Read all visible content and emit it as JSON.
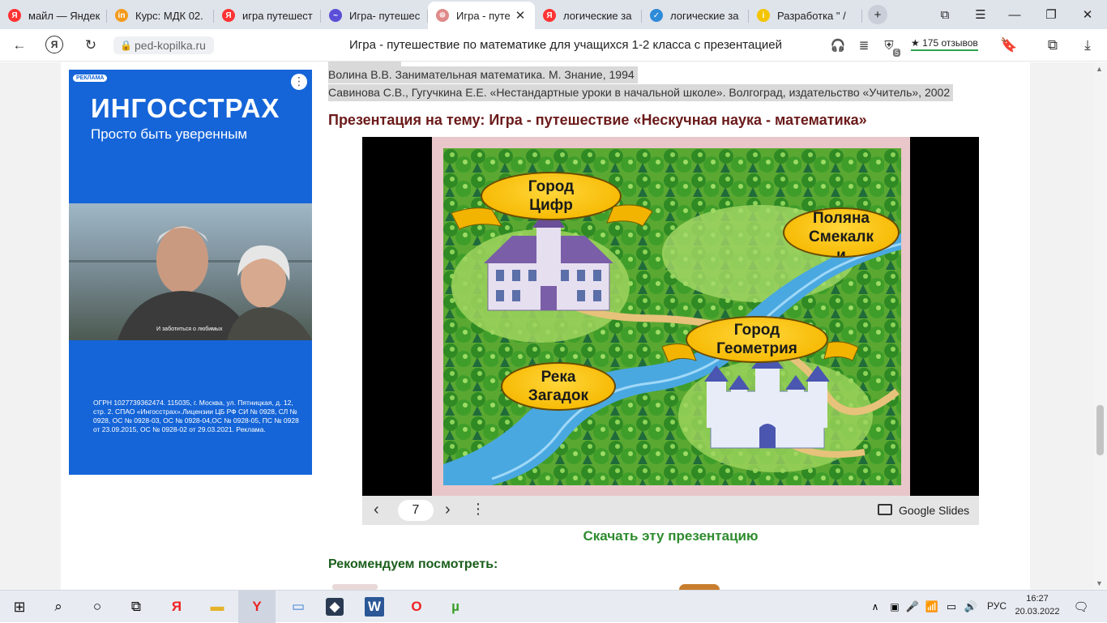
{
  "browser": {
    "tabs": [
      {
        "label": "майл — Яндек",
        "favicon": "Я",
        "favicon_color": "#f33"
      },
      {
        "label": "Курс: МДК 02.",
        "favicon": "in",
        "favicon_color": "#f39a1c"
      },
      {
        "label": "игра путешест",
        "favicon": "Я",
        "favicon_color": "#f33"
      },
      {
        "label": "Игра- путешес",
        "favicon": "~",
        "favicon_color": "#5b4fd8"
      },
      {
        "label": "Игра - путе",
        "favicon": "☸",
        "favicon_color": "#e08a8a",
        "active": true
      },
      {
        "label": "логические за",
        "favicon": "Я",
        "favicon_color": "#f33"
      },
      {
        "label": "логические за",
        "favicon": "✓",
        "favicon_color": "#2e8bd8"
      },
      {
        "label": "Разработка \" /",
        "favicon": "i",
        "favicon_color": "#f5c400"
      }
    ],
    "domain": "ped-kopilka.ru",
    "page_title": "Игра - путешествие по математике для учащихся 1-2 класса с презентацией",
    "reviews": "★ 175 отзывов",
    "counter_badge": "5"
  },
  "content": {
    "references": [
      "Волина В.В. Занимательная математика. М. Знание, 1994",
      "Савинова С.В., Гугучкина Е.Е. «Нестандартные уроки в начальной школе». Волгоград, издательство «Учитель», 2002"
    ],
    "presentation_heading": "Презентация на тему: Игра - путешествие «Нескучная наука - математика»",
    "download_link": "Скачать эту презентацию",
    "recommend_heading": "Рекомендуем посмотреть:"
  },
  "slide": {
    "labels": {
      "city_digits": "Город\nЦифр",
      "meadow": "Поляна\nСмекалк\nи",
      "city_geometry": "Город\nГеометрия",
      "river": "Река\nЗагадок"
    },
    "current_page": "7",
    "provider": "Google Slides"
  },
  "ad": {
    "badge": "РЕКЛАМА",
    "brand": "ИНГОССТРАХ",
    "tagline": "Просто быть уверенным",
    "photo_caption": "И заботиться о любимых",
    "legal": "ОГРН 1027739362474. 115035, г. Москва, ул. Пятницкая, д. 12, стр. 2. СПАО «Ингосстрах».Лицензии ЦБ РФ СИ № 0928, СЛ № 0928, ОС № 0928-03, ОС № 0928-04,ОС № 0928-05, ПС № 0928 от 23.09.2015, ОС № 0928-02 от 29.03.2021. Реклама."
  },
  "taskbar": {
    "language": "РУС",
    "time": "16:27",
    "date": "20.03.2022"
  }
}
